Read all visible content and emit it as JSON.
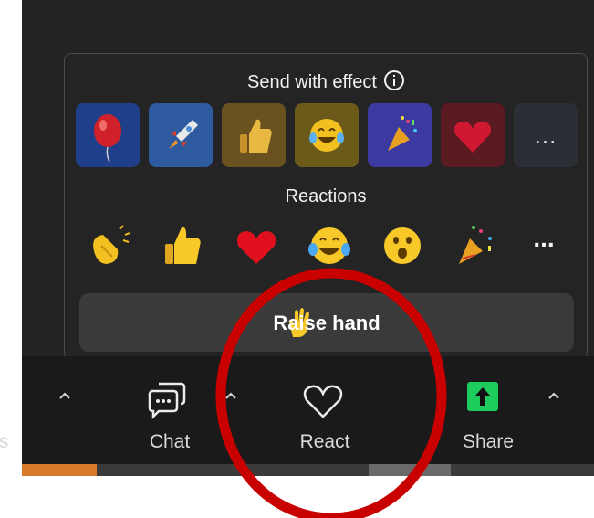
{
  "popup": {
    "effects_title": "Send with effect",
    "info_icon": "info-icon",
    "effects": [
      {
        "name": "balloon",
        "bg": "#1f3f8a"
      },
      {
        "name": "rocket",
        "bg": "#2e5aa0"
      },
      {
        "name": "thumbs-up",
        "bg": "#6a5220"
      },
      {
        "name": "tears-of-joy",
        "bg": "#6b5a1a"
      },
      {
        "name": "party-popper",
        "bg": "#3c3aa0"
      },
      {
        "name": "heart",
        "bg": "#5a1a22"
      }
    ],
    "effects_more": "...",
    "reactions_title": "Reactions",
    "reactions": [
      "clapping-hands",
      "thumbs-up",
      "red-heart",
      "tears-of-joy",
      "astonished-face",
      "party-popper"
    ],
    "reactions_more": "...",
    "raise_hand_label": "Raise hand"
  },
  "toolbar": {
    "left_partial_label": "s",
    "chat_label": "Chat",
    "react_label": "React",
    "share_label": "Share",
    "share_icon_color": "#1ecb5d"
  },
  "annotation": {
    "color": "#c80000"
  }
}
